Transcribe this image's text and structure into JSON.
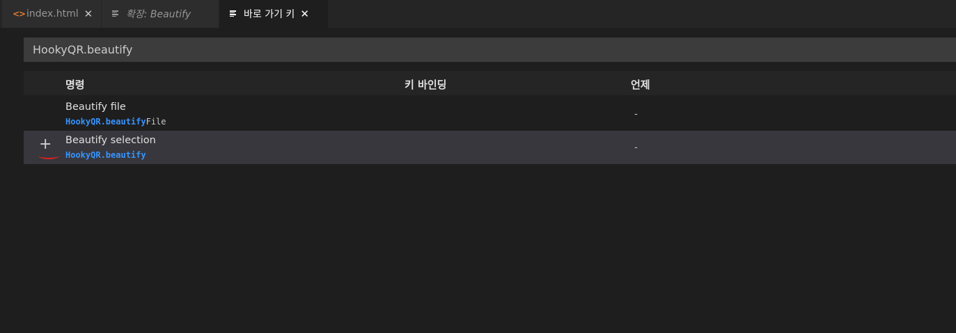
{
  "tabs": [
    {
      "label": "index.html",
      "icon": "code-icon",
      "icon_glyph": "<>",
      "closable": true
    },
    {
      "label": "확장: Beautify",
      "icon": "document-lines-icon",
      "closable": false
    },
    {
      "label": "바로 가기 키",
      "icon": "document-lines-icon",
      "closable": true,
      "active": true
    }
  ],
  "close_glyph": "✕",
  "search": {
    "value": "HookyQR.beautify"
  },
  "table": {
    "headers": {
      "command": "명령",
      "keybinding": "키 바인딩",
      "when": "언제"
    },
    "rows": [
      {
        "title": "Beautify file",
        "id_highlight": "HookyQR.beautify",
        "id_rest": "File",
        "keybinding": "",
        "when": "-"
      },
      {
        "title": "Beautify selection",
        "id_highlight": "HookyQR.beautify",
        "id_rest": "",
        "keybinding": "",
        "when": "-",
        "selected": true,
        "add_glyph": "+"
      }
    ]
  },
  "colors": {
    "background": "#1e1e1e",
    "tab_inactive": "#2d2d2d",
    "search_bg": "#3c3c3c",
    "header_bg": "#252526",
    "row_selected": "#37373d",
    "highlight": "#3794ff",
    "code_icon": "#e37933",
    "annotation_red": "#e02020"
  }
}
